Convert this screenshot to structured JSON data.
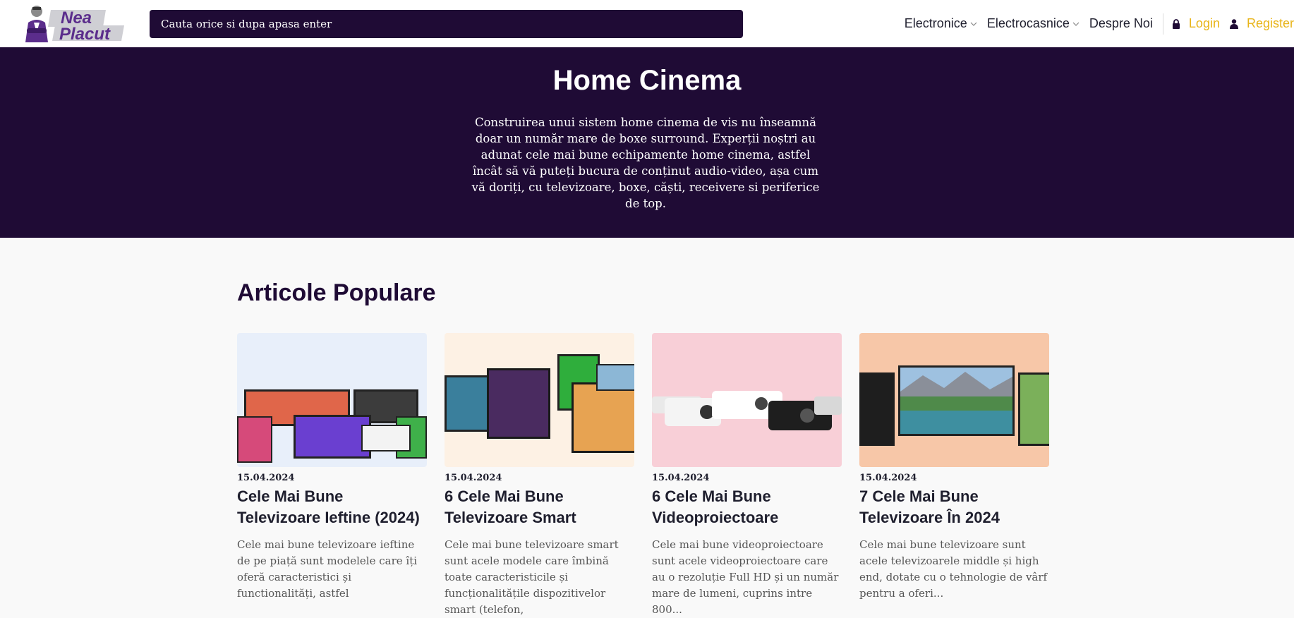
{
  "header": {
    "logo_text_line1": "Nea",
    "logo_text_line2": "Placut",
    "search": {
      "placeholder": "Cauta orice si dupa apasa enter"
    },
    "nav": [
      {
        "label": "Electronice",
        "has_dropdown": true
      },
      {
        "label": "Electrocasnice",
        "has_dropdown": true
      },
      {
        "label": "Despre Noi",
        "has_dropdown": false
      }
    ],
    "auth": {
      "login_label": "Login",
      "register_label": "Register"
    }
  },
  "hero": {
    "title": "Home Cinema",
    "description": "Construirea unui sistem home cinema de vis nu înseamnă doar un număr mare de boxe surround. Experții noștri au adunat cele mai bune echipamente home cinema, astfel încât să vă puteți bucura de conținut audio-video, așa cum vă doriți, cu televizoare, boxe, căști, receivere si periferice de top."
  },
  "articles": {
    "section_title": "Articole Populare",
    "items": [
      {
        "date": "15.04.2024",
        "title": "Cele Mai Bune Televizoare Ieftine (2024)",
        "excerpt": "Cele mai bune televizoare ieftine de pe piață sunt modelele care îți oferă caracteristici și functionalități, astfel",
        "image": "tv-collage-light-blue"
      },
      {
        "date": "15.04.2024",
        "title": "6 Cele Mai Bune Televizoare Smart",
        "excerpt": "Cele mai bune televizoare smart sunt acele modele care îmbină toate caracteristicile și funcționalitățile dispozitivelor smart (telefon,",
        "image": "tv-collage-cream"
      },
      {
        "date": "15.04.2024",
        "title": "6 Cele Mai Bune Videoproiectoare",
        "excerpt": "Cele mai bune videoproiectoare sunt acele videoproiectoare care au o rezoluție Full HD și un număr mare de lumeni, cuprins intre 800...",
        "image": "projectors-pink"
      },
      {
        "date": "15.04.2024",
        "title": "7 Cele Mai Bune Televizoare În 2024",
        "excerpt": "Cele mai bune televizoare sunt acele televizoarele middle și high end, dotate cu o tehnologie de vârf pentru a oferi...",
        "image": "tv-collage-peach"
      }
    ]
  },
  "colors": {
    "brand_dark": "#1f0b35",
    "accent_yellow": "#e8b418",
    "page_background": "#f9f9f9"
  }
}
